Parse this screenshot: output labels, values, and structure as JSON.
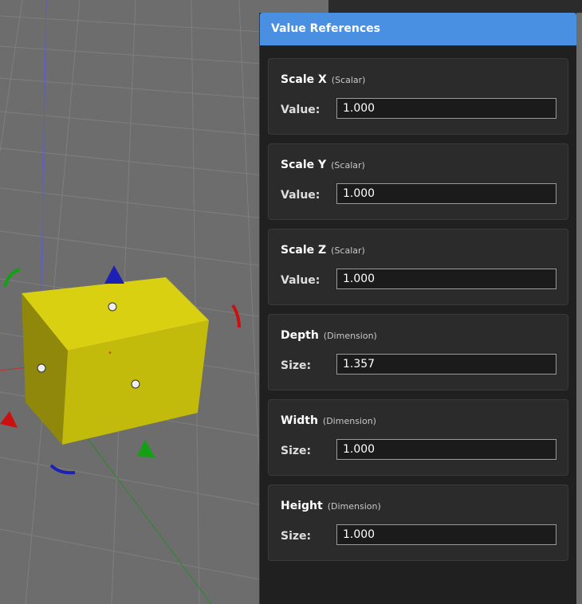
{
  "panel": {
    "title": "Value References",
    "cards": [
      {
        "name": "Scale X",
        "type": "(Scalar)",
        "label": "Value:",
        "value": "1.000"
      },
      {
        "name": "Scale Y",
        "type": "(Scalar)",
        "label": "Value:",
        "value": "1.000"
      },
      {
        "name": "Scale Z",
        "type": "(Scalar)",
        "label": "Value:",
        "value": "1.000"
      },
      {
        "name": "Depth",
        "type": "(Dimension)",
        "label": "Size:",
        "value": "1.357"
      },
      {
        "name": "Width",
        "type": "(Dimension)",
        "label": "Size:",
        "value": "1.000"
      },
      {
        "name": "Height",
        "type": "(Dimension)",
        "label": "Size:",
        "value": "1.000"
      }
    ]
  },
  "viewport": {
    "colors": {
      "background": "#6d6d6d",
      "grid": "#808080",
      "box": "#c9c20d",
      "x_axis": "#cc1010",
      "y_axis": "#1aa01a",
      "z_axis": "#1a1acc"
    }
  }
}
